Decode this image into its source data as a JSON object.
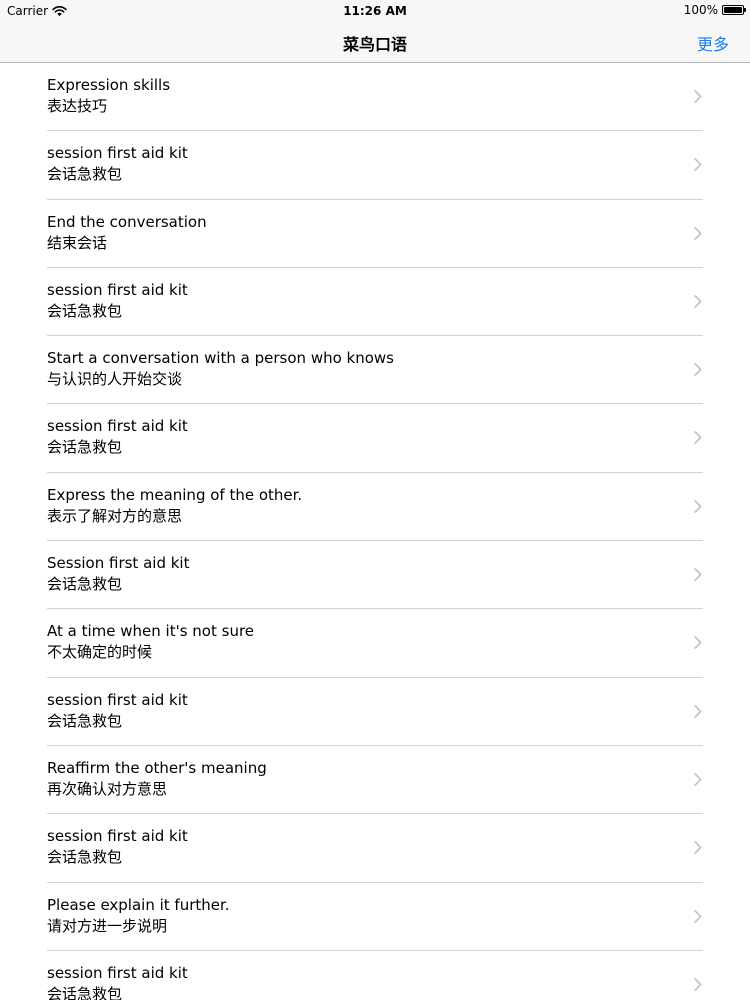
{
  "status_bar": {
    "carrier": "Carrier",
    "time": "11:26 AM",
    "battery": "100%",
    "battery_level": 1.0
  },
  "nav": {
    "title": "菜鸟口语",
    "more_label": "更多",
    "more_color": "#1a7ee8"
  },
  "list": {
    "items": [
      {
        "title": "Expression skills",
        "subtitle": "表达技巧"
      },
      {
        "title": "session first aid kit",
        "subtitle": "会话急救包"
      },
      {
        "title": "End the conversation",
        "subtitle": "结束会话"
      },
      {
        "title": "session first aid kit",
        "subtitle": "会话急救包"
      },
      {
        "title": "Start a conversation with a person who knows",
        "subtitle": "与认识的人开始交谈"
      },
      {
        "title": "session first aid kit",
        "subtitle": "会话急救包"
      },
      {
        "title": "Express the meaning of the other.",
        "subtitle": "表示了解对方的意思"
      },
      {
        "title": "Session first aid kit",
        "subtitle": "会话急救包"
      },
      {
        "title": "At a time when it's not sure",
        "subtitle": "不太确定的时候"
      },
      {
        "title": "session first aid kit",
        "subtitle": "会话急救包"
      },
      {
        "title": "Reaffirm the other's meaning",
        "subtitle": "再次确认对方意思"
      },
      {
        "title": "session first aid kit",
        "subtitle": "会话急救包"
      },
      {
        "title": "Please explain it further.",
        "subtitle": "请对方进一步说明"
      },
      {
        "title": "session first aid kit",
        "subtitle": "会话急救包"
      }
    ]
  }
}
